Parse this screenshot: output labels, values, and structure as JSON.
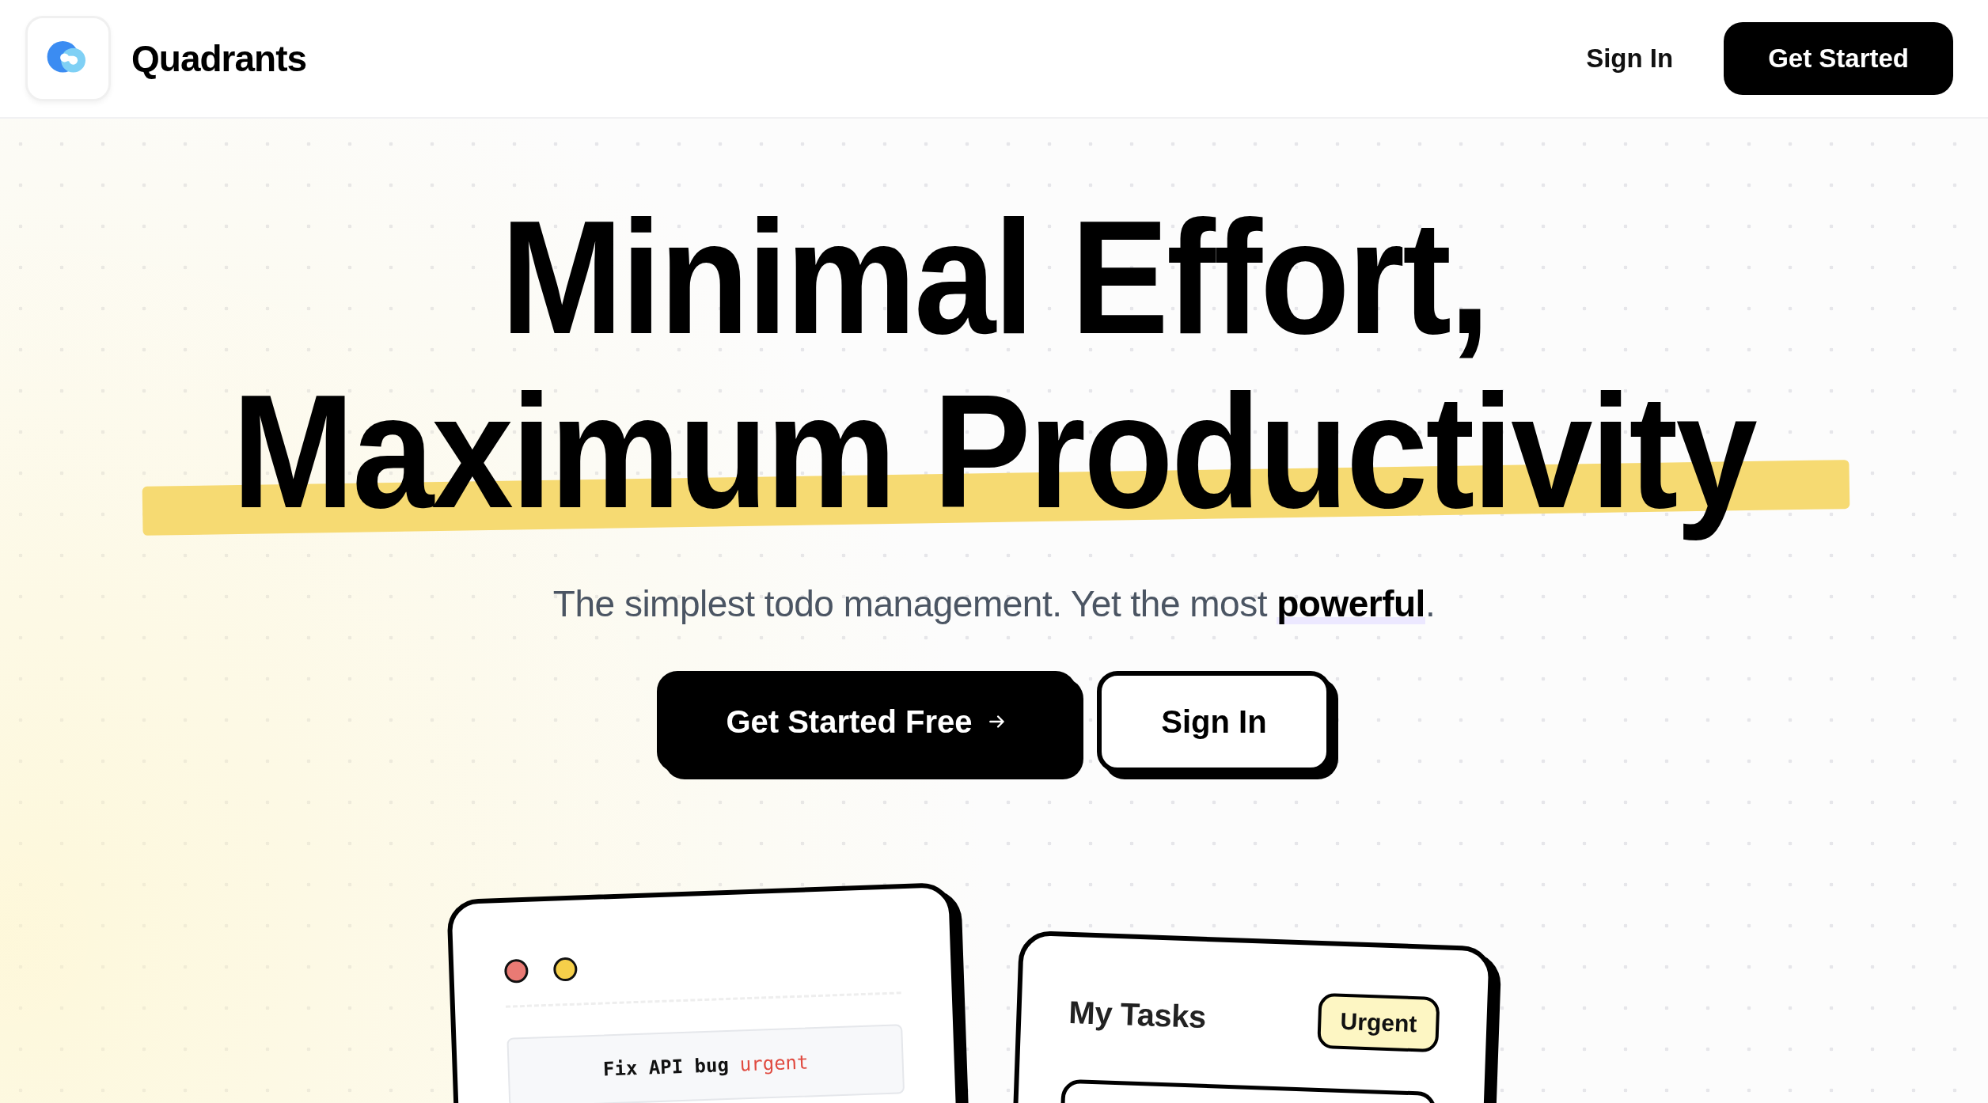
{
  "header": {
    "brand": "Quadrants",
    "nav": [
      {
        "label": "Sign In",
        "kind": "link"
      },
      {
        "label": "Get Started",
        "kind": "primary"
      }
    ]
  },
  "hero": {
    "title_lines": [
      {
        "text": "Minimal Effort,",
        "highlighted": false
      },
      {
        "text": "Maximum Productivity",
        "highlighted": true
      }
    ],
    "subtitle": "The simplest todo management. Yet the most **powerful**.",
    "buttons": [
      {
        "label": "Get Started Free",
        "kind": "primary",
        "arrow": true
      },
      {
        "label": "Sign In",
        "kind": "secondary",
        "arrow": false
      }
    ]
  },
  "preview_cards": [
    {
      "kind": "code",
      "window_dots": [
        {
          "color": "#e97a74"
        },
        {
          "color": "#f5cf4a"
        }
      ],
      "code_text": "Fix API bug",
      "code_tag": "urgent"
    },
    {
      "kind": "tasks",
      "title": "My Tasks",
      "badge": "Urgent"
    }
  ]
}
